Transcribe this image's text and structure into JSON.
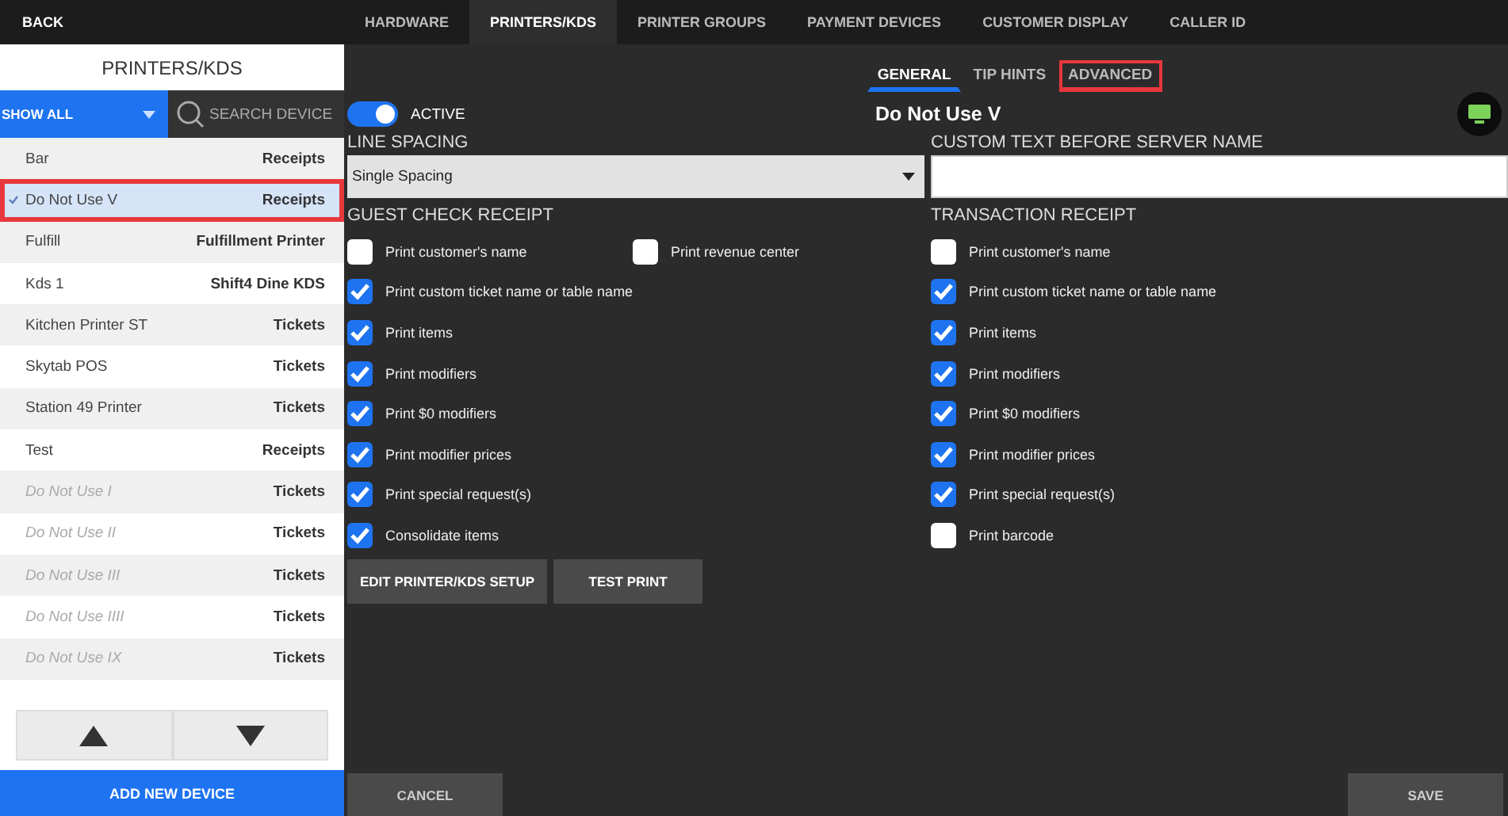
{
  "top_nav": {
    "back": "BACK",
    "tabs": [
      {
        "label": "HARDWARE",
        "selected": false
      },
      {
        "label": "PRINTERS/KDS",
        "selected": true
      },
      {
        "label": "PRINTER GROUPS",
        "selected": false
      },
      {
        "label": "PAYMENT DEVICES",
        "selected": false
      },
      {
        "label": "CUSTOMER DISPLAY",
        "selected": false
      },
      {
        "label": "CALLER ID",
        "selected": false
      }
    ]
  },
  "sidebar": {
    "title": "PRINTERS/KDS",
    "filter": "SHOW ALL",
    "search": {
      "placeholder": "SEARCH DEVICE"
    },
    "items": [
      {
        "name": "Bar",
        "type": "Receipts",
        "selected": false,
        "inactive": false,
        "highlighted": false
      },
      {
        "name": "Do Not Use V",
        "type": "Receipts",
        "selected": true,
        "inactive": false,
        "highlighted": true
      },
      {
        "name": "Fulfill",
        "type": "Fulfillment Printer",
        "selected": false,
        "inactive": false,
        "highlighted": false
      },
      {
        "name": "Kds 1",
        "type": "Shift4 Dine KDS",
        "selected": false,
        "inactive": false,
        "highlighted": false
      },
      {
        "name": "Kitchen Printer ST",
        "type": "Tickets",
        "selected": false,
        "inactive": false,
        "highlighted": false
      },
      {
        "name": "Skytab POS",
        "type": "Tickets",
        "selected": false,
        "inactive": false,
        "highlighted": false
      },
      {
        "name": "Station 49 Printer",
        "type": "Tickets",
        "selected": false,
        "inactive": false,
        "highlighted": false
      },
      {
        "name": "Test",
        "type": "Receipts",
        "selected": false,
        "inactive": false,
        "highlighted": false
      },
      {
        "name": "Do Not Use I",
        "type": "Tickets",
        "selected": false,
        "inactive": true,
        "highlighted": false
      },
      {
        "name": "Do Not Use II",
        "type": "Tickets",
        "selected": false,
        "inactive": true,
        "highlighted": false
      },
      {
        "name": "Do Not Use III",
        "type": "Tickets",
        "selected": false,
        "inactive": true,
        "highlighted": false
      },
      {
        "name": "Do Not Use IIII",
        "type": "Tickets",
        "selected": false,
        "inactive": true,
        "highlighted": false
      },
      {
        "name": "Do Not Use IX",
        "type": "Tickets",
        "selected": false,
        "inactive": true,
        "highlighted": false
      }
    ],
    "add_button": "ADD NEW DEVICE"
  },
  "sub_tabs": [
    {
      "label": "GENERAL",
      "selected": true,
      "highlighted": false
    },
    {
      "label": "TIP HINTS",
      "selected": false,
      "highlighted": false
    },
    {
      "label": "ADVANCED",
      "selected": false,
      "highlighted": true
    }
  ],
  "active_toggle": {
    "label": "ACTIVE",
    "on": true
  },
  "device_title": "Do Not Use V",
  "line_spacing": {
    "label": "LINE SPACING",
    "value": "Single Spacing"
  },
  "custom_text": {
    "label": "CUSTOM TEXT BEFORE SERVER NAME"
  },
  "guest_check": {
    "title": "GUEST CHECK RECEIPT",
    "options": [
      {
        "label": "Print customer's name",
        "checked": false
      },
      {
        "label": "Print custom ticket name or table name",
        "checked": true
      },
      {
        "label": "Print items",
        "checked": true
      },
      {
        "label": "Print modifiers",
        "checked": true
      },
      {
        "label": "Print $0 modifiers",
        "checked": true
      },
      {
        "label": "Print modifier prices",
        "checked": true
      },
      {
        "label": "Print special request(s)",
        "checked": true
      },
      {
        "label": "Consolidate items",
        "checked": true
      }
    ],
    "extra_option": {
      "label": "Print revenue center",
      "checked": false
    }
  },
  "transaction": {
    "title": "TRANSACTION RECEIPT",
    "options": [
      {
        "label": "Print customer's name",
        "checked": false
      },
      {
        "label": "Print custom ticket name or table name",
        "checked": true
      },
      {
        "label": "Print items",
        "checked": true
      },
      {
        "label": "Print modifiers",
        "checked": true
      },
      {
        "label": "Print $0 modifiers",
        "checked": true
      },
      {
        "label": "Print modifier prices",
        "checked": true
      },
      {
        "label": "Print special request(s)",
        "checked": true
      },
      {
        "label": "Print barcode",
        "checked": false
      }
    ]
  },
  "actions": [
    "EDIT PRINTER/KDS SETUP",
    "TEST PRINT"
  ],
  "footer": {
    "cancel": "CANCEL",
    "save": "SAVE"
  }
}
